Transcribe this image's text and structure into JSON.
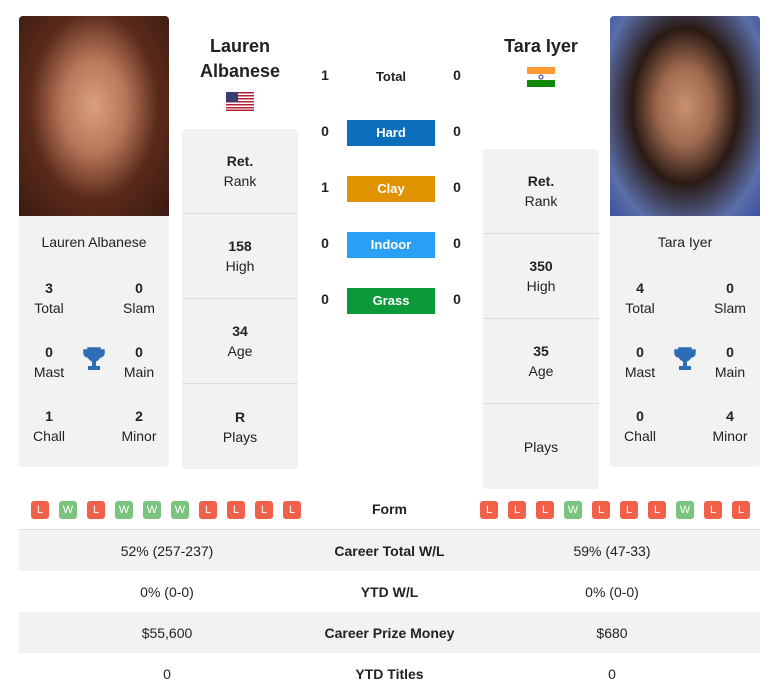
{
  "player1": {
    "name": "Lauren Albanese",
    "name_line1": "Lauren",
    "name_line2": "Albanese",
    "flag": "us-flag",
    "total": "3",
    "total_label": "Total",
    "slam": "0",
    "slam_label": "Slam",
    "mast": "0",
    "mast_label": "Mast",
    "main": "0",
    "main_label": "Main",
    "chall": "1",
    "chall_label": "Chall",
    "minor": "2",
    "minor_label": "Minor",
    "stats": [
      {
        "value": "Ret.",
        "label": "Rank"
      },
      {
        "value": "158",
        "label": "High"
      },
      {
        "value": "34",
        "label": "Age"
      },
      {
        "value": "R",
        "label": "Plays"
      }
    ],
    "form": [
      "L",
      "W",
      "L",
      "W",
      "W",
      "W",
      "L",
      "L",
      "L",
      "L"
    ]
  },
  "player2": {
    "name": "Tara Iyer",
    "flag": "india-flag",
    "total": "4",
    "total_label": "Total",
    "slam": "0",
    "slam_label": "Slam",
    "mast": "0",
    "mast_label": "Mast",
    "main": "0",
    "main_label": "Main",
    "chall": "0",
    "chall_label": "Chall",
    "minor": "4",
    "minor_label": "Minor",
    "stats": [
      {
        "value": "Ret.",
        "label": "Rank"
      },
      {
        "value": "350",
        "label": "High"
      },
      {
        "value": "35",
        "label": "Age"
      },
      {
        "value": "",
        "label": "Plays"
      }
    ],
    "form": [
      "L",
      "L",
      "L",
      "W",
      "L",
      "L",
      "L",
      "W",
      "L",
      "L"
    ]
  },
  "h2h": [
    {
      "label": "Total",
      "p1": "1",
      "p2": "0",
      "color": ""
    },
    {
      "label": "Hard",
      "p1": "0",
      "p2": "0",
      "color": "#0a6ebd"
    },
    {
      "label": "Clay",
      "p1": "1",
      "p2": "0",
      "color": "#e09200"
    },
    {
      "label": "Indoor",
      "p1": "0",
      "p2": "0",
      "color": "#2aa0f5"
    },
    {
      "label": "Grass",
      "p1": "0",
      "p2": "0",
      "color": "#0b9a3a"
    }
  ],
  "form_label": "Form",
  "colors": {
    "win": "#7bc47f",
    "loss": "#f0604a"
  },
  "table": [
    {
      "label": "Career Total W/L",
      "p1": "52% (257-237)",
      "p2": "59% (47-33)"
    },
    {
      "label": "YTD W/L",
      "p1": "0% (0-0)",
      "p2": "0% (0-0)"
    },
    {
      "label": "Career Prize Money",
      "p1": "$55,600",
      "p2": "$680"
    },
    {
      "label": "YTD Titles",
      "p1": "0",
      "p2": "0"
    }
  ]
}
